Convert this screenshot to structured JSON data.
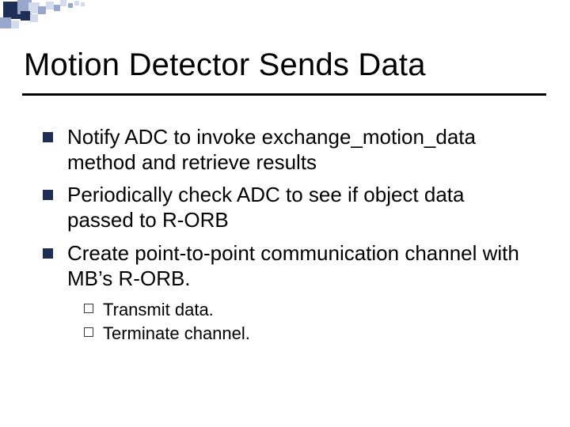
{
  "title": "Motion Detector Sends Data",
  "bullets": [
    {
      "text": "Notify ADC to invoke exchange_motion_data method and retrieve results"
    },
    {
      "text": "Periodically check ADC to see if object data passed to R-ORB"
    },
    {
      "text": "Create point-to-point communication channel with MB’s R-ORB."
    }
  ],
  "sub_bullets": [
    {
      "text": "Transmit data."
    },
    {
      "text": "Terminate channel."
    }
  ],
  "decor_colors": {
    "dark": "#1f2e55",
    "mid": "#9aa7cc",
    "light": "#d4dbec"
  }
}
